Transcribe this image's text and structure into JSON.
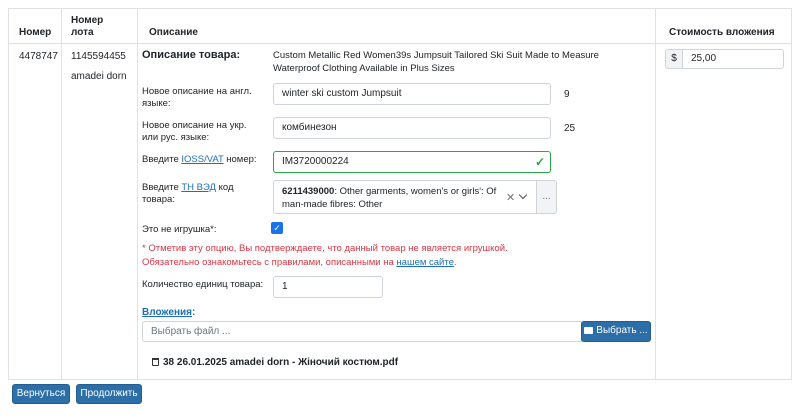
{
  "table": {
    "headers": {
      "number": "Номер",
      "lot_number": "Номер лота",
      "description": "Описание",
      "investment_value": "Стоимость вложения"
    },
    "row": {
      "number": "4478747",
      "lot_number": "1145594455",
      "seller": "amadei dorn",
      "product_description_label": "Описание товара:",
      "product_description_value": "Custom Metallic Red Women39s Jumpsuit Tailored Ski Suit Made to Measure Waterproof Clothing Available in Plus Sizes",
      "new_desc_en_label": "Новое описание на англ. языке:",
      "new_desc_en_value": "winter ski custom Jumpsuit",
      "new_desc_en_count": "9",
      "new_desc_ua_label": "Новое описание на укр. или рус. языке:",
      "new_desc_ua_value": "комбинезон",
      "new_desc_ua_count": "25",
      "ioss_label_prefix": "Введите ",
      "ioss_label_link": "IOSS/VAT",
      "ioss_label_suffix": " номер:",
      "ioss_value": "IM3720000224",
      "hs_label_prefix": "Введите ",
      "hs_label_link": "ТН ВЭД",
      "hs_label_suffix": " код товара:",
      "hs_code_bold": "6211439000",
      "hs_code_text": ": Other garments, women's or girls': Of man-made fibres: Other",
      "hs_more_button": "...",
      "not_toy_label": "Это не игрушка*:",
      "not_toy_checked": true,
      "warning_line1": "* Отметив эту опцию, Вы подтверждаете, что данный товар не является игрушкой.",
      "warning_line2_prefix": "Обязательно ознакомьтесь с правилами, описанными на ",
      "warning_line2_link": "нашем сайте",
      "warning_line2_suffix": ".",
      "quantity_label": "Количество единиц товара:",
      "quantity_value": "1",
      "attachments_label": "Вложения",
      "attachments_colon": ":",
      "file_placeholder": "Выбрать файл ...",
      "file_button": "Выбрать ...",
      "attached_file": "38 26.01.2025 amadei dorn - Жіночий костюм.pdf",
      "currency_symbol": "$",
      "investment_value": "25,00"
    }
  },
  "buttons": {
    "back": "Вернуться",
    "continue": "Продолжить"
  },
  "colors": {
    "primary": "#2c6ea8",
    "valid": "#28a745",
    "danger": "#dc3545",
    "link": "#1e6fb8",
    "checkbox": "#1a73e8"
  },
  "icons": {
    "valid": "check-icon",
    "clear": "clear-x-icon",
    "dropdown": "chevron-down-icon",
    "folder": "folder-open-icon",
    "trash": "trash-icon"
  }
}
